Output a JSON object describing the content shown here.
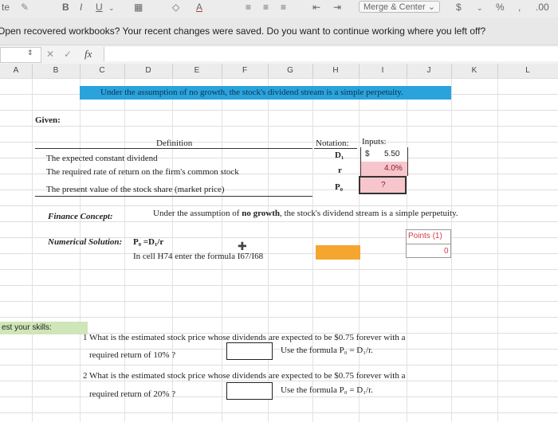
{
  "toolbar": {
    "left_clip": "te",
    "bold": "B",
    "italic": "I",
    "underline": "U",
    "font_color_letter": "A",
    "merge_center": "Merge & Center",
    "dollar": "$",
    "percent": "%"
  },
  "message_bar": {
    "text": "Open recovered workbooks? Your recent changes were saved. Do you want to continue working where you left off?"
  },
  "formula_bar": {
    "cancel": "✕",
    "confirm": "✓",
    "fx": "fx"
  },
  "columns": [
    "A",
    "B",
    "C",
    "D",
    "E",
    "F",
    "G",
    "H",
    "I",
    "J",
    "K",
    "L"
  ],
  "sheet": {
    "banner": "Under the assumption of no growth, the stock's dividend stream is a simple perpetuity.",
    "given": "Given:",
    "definition_header": "Definition",
    "notation_header": "Notation:",
    "inputs_header": "Inputs:",
    "rows": [
      {
        "definition": "The expected constant dividend",
        "notation": "D₁",
        "currency": "$",
        "value": "5.50"
      },
      {
        "definition": "The required rate of return on the firm's common stock",
        "notation": "r",
        "currency": "",
        "value": "4.0%"
      },
      {
        "definition": "The present value of the stock share (market price)",
        "notation": "P₀",
        "currency": "",
        "value": "?"
      }
    ],
    "finance_concept_label": "Finance Concept:",
    "finance_concept_pre": "Under the assumption of ",
    "finance_concept_bold": "no growth",
    "finance_concept_post": ", the stock's dividend stream is a simple perpetuity.",
    "numerical_solution_label": "Numerical Solution:",
    "numerical_solution_formula": "P₀ =D₁/r",
    "instruction": "In cell H74 enter the formula I67/I68",
    "points_label": "Points (1)",
    "points_value": "0",
    "skills_label": "est your skills:",
    "q1_num": "1",
    "q1_line1": "What is the estimated stock price whose dividends are expected to be $0.75 forever with a",
    "q1_line2": "required return of 10% ?",
    "q1_hint": "Use the formula P₀ = D₁/r.",
    "q2_num": "2",
    "q2_line1": "What is the estimated stock price whose dividends are expected to be $0.75 forever with a",
    "q2_line2": "required return of 20% ?",
    "q2_hint": "Use the formula P₀ = D₁/r."
  },
  "colors": {
    "banner_bg": "#2aa3dc",
    "input_fill": "#f7c6cc",
    "orange_cell": "#f4a62e",
    "skills_fill": "#cfe6b8",
    "points_text": "#d43a4a"
  }
}
